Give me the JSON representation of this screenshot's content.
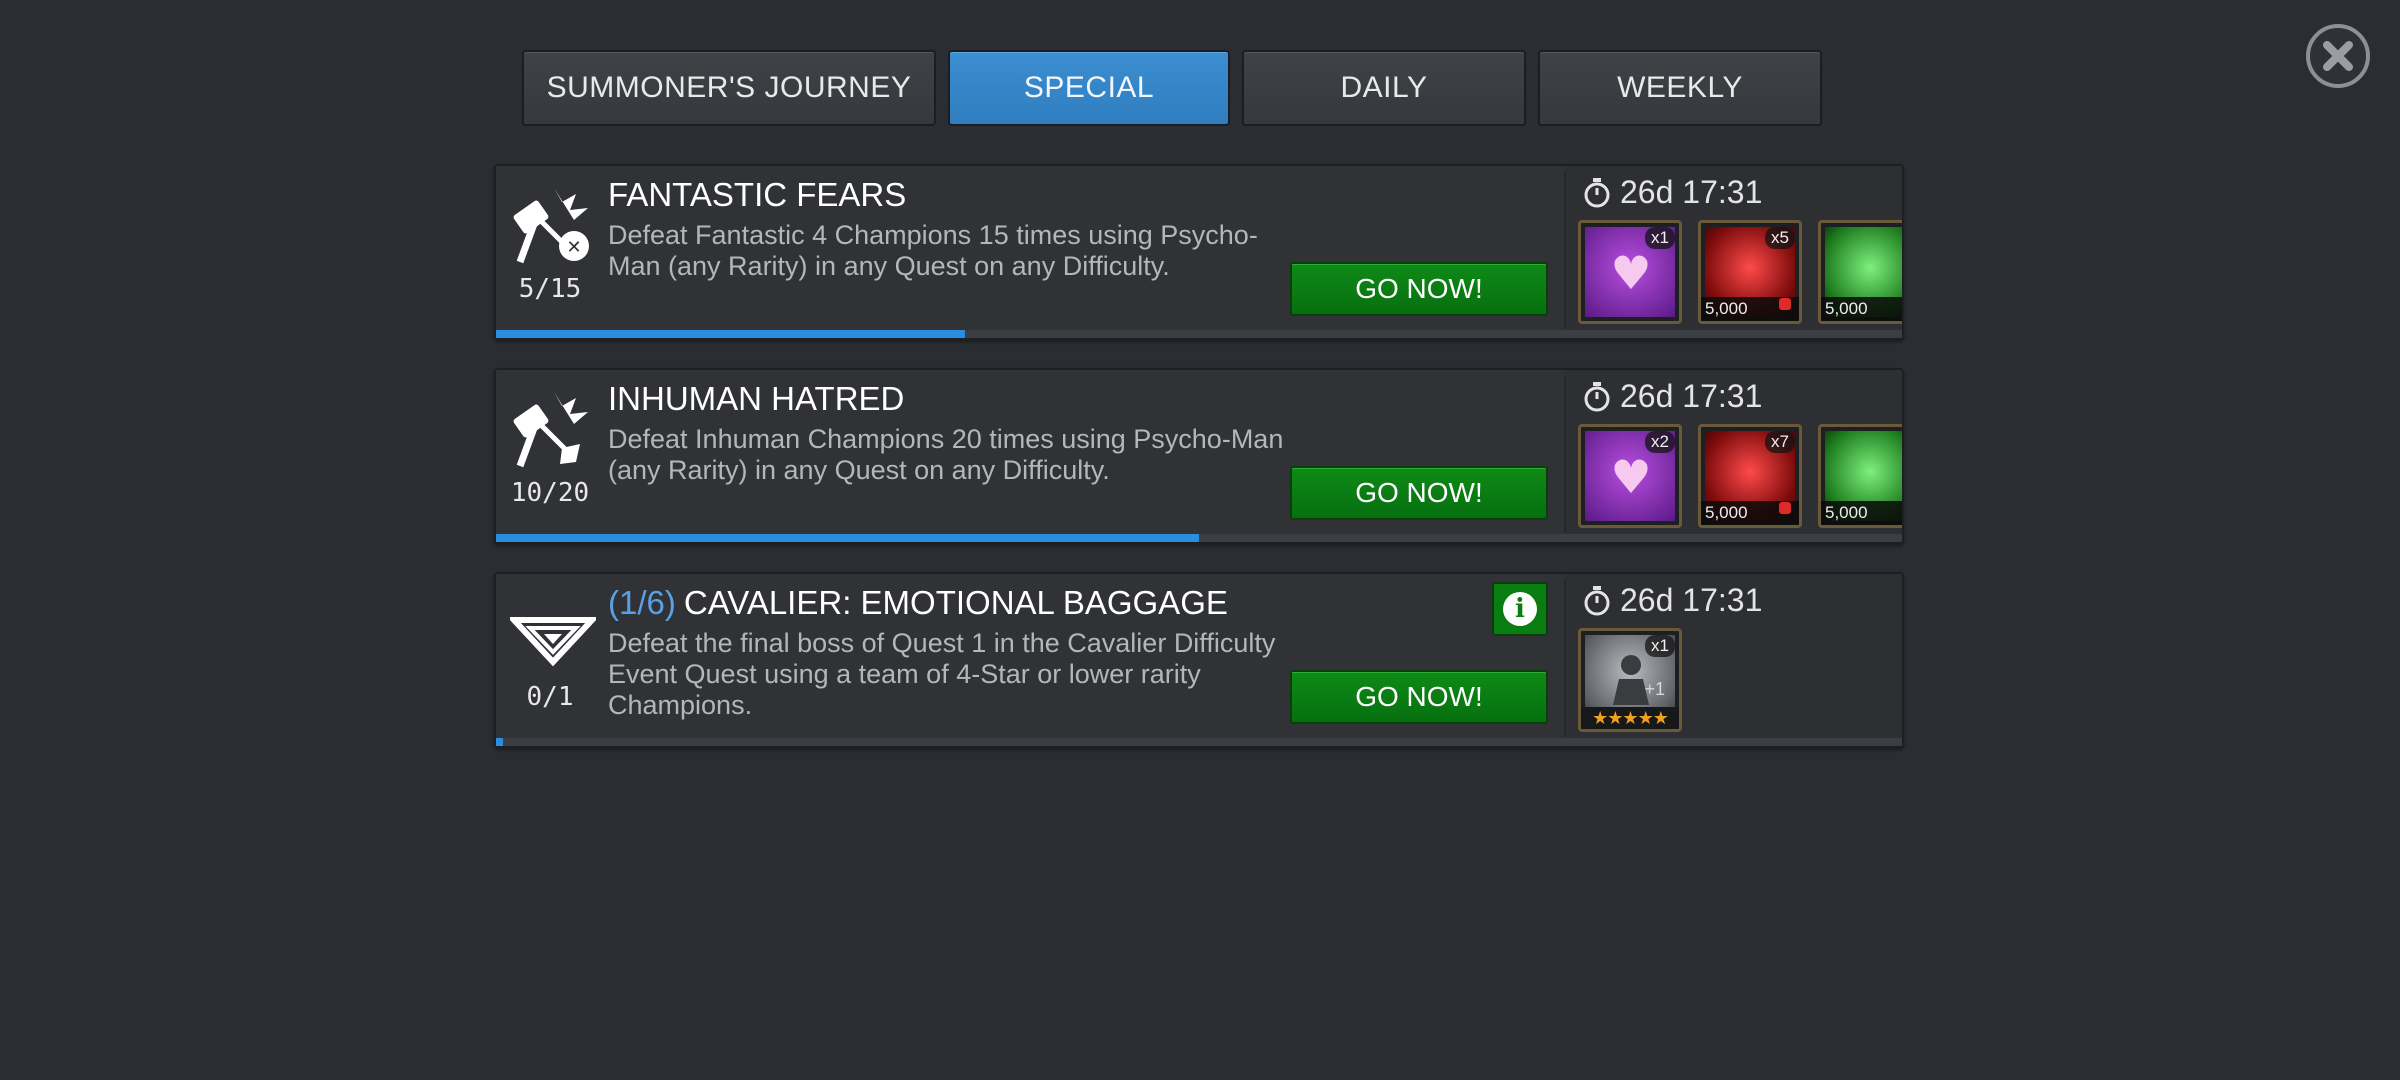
{
  "close": {
    "icon": "close-icon"
  },
  "tabs": [
    {
      "label": "SUMMONER'S JOURNEY",
      "active": false
    },
    {
      "label": "SPECIAL",
      "active": true
    },
    {
      "label": "DAILY",
      "active": false
    },
    {
      "label": "WEEKLY",
      "active": false
    }
  ],
  "colors": {
    "accent": "#2f86cc",
    "go_button": "#0a7d12",
    "progress": "#2a8de0",
    "title_prefix": "#5aa0e6"
  },
  "quests": [
    {
      "icon": "hammer-crossed-icon",
      "title": "FANTASTIC FEARS",
      "description": "Defeat Fantastic 4 Champions 15 times using Psycho-Man (any Rarity) in any Quest on any Difficulty.",
      "progress_text": "5/15",
      "progress_fraction": 0.3333,
      "button": "GO NOW!",
      "timer": "26d 17:31",
      "rewards": [
        {
          "icon": "purple-heart-crystal-icon",
          "qty": "x1"
        },
        {
          "icon": "red-crystal-icon",
          "qty": "x5",
          "amount": "5,000"
        },
        {
          "icon": "green-crystal-icon",
          "amount": "5,000"
        }
      ]
    },
    {
      "icon": "hammer-crossed-icon",
      "title": "INHUMAN HATRED",
      "description": "Defeat Inhuman Champions 20 times using Psycho-Man (any Rarity) in any Quest on any Difficulty.",
      "progress_text": "10/20",
      "progress_fraction": 0.5,
      "button": "GO NOW!",
      "timer": "26d 17:31",
      "rewards": [
        {
          "icon": "purple-heart-crystal-icon",
          "qty": "x2"
        },
        {
          "icon": "red-crystal-icon",
          "qty": "x7",
          "amount": "5,000"
        },
        {
          "icon": "green-crystal-icon",
          "amount": "5,000"
        }
      ]
    },
    {
      "icon": "cavalier-chevron-icon",
      "title_prefix": "(1/6)",
      "title": "CAVALIER: EMOTIONAL BAGGAGE",
      "description": "Defeat the final boss of Quest 1 in the Cavalier Difficulty Event Quest using a team of 4-Star or lower rarity Champions.",
      "progress_text": "0/1",
      "progress_fraction": 0.005,
      "button": "GO NOW!",
      "info_icon": "info-icon",
      "timer": "26d 17:31",
      "rewards": [
        {
          "icon": "champion-crystal-icon",
          "qty": "x1",
          "extra": "+1",
          "stars": "★★★★★"
        }
      ]
    }
  ]
}
